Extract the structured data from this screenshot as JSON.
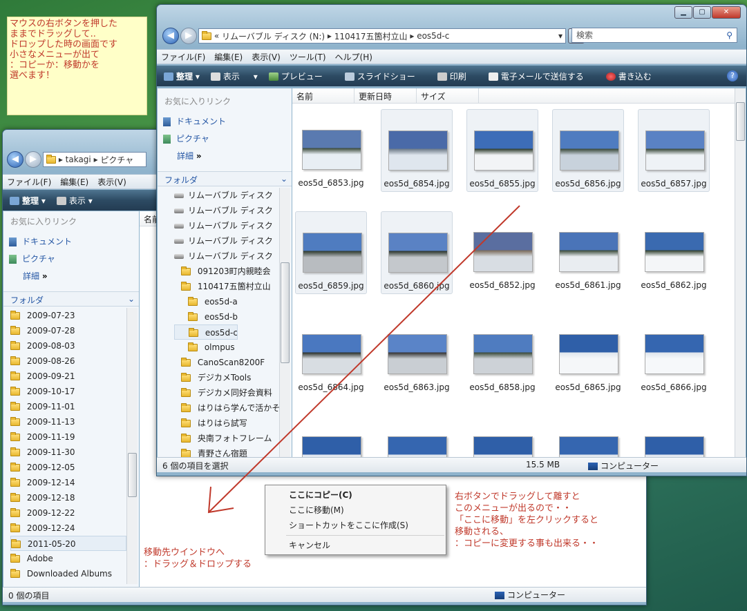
{
  "note": "マウスの右ボタンを押した\nままでドラッグして..\nドロップした時の画面です\n小さなメニューが出て\n：コピーか：移動かを\n選べます！",
  "back_window": {
    "breadcrumb": [
      "takagi",
      "ピクチャ"
    ],
    "menu": [
      "ファイル(F)",
      "編集(E)",
      "表示(V)"
    ],
    "toolbar": [
      "整理",
      "表示"
    ],
    "fav_header": "お気に入りリンク",
    "favs": [
      "ドキュメント",
      "ピクチャ"
    ],
    "more": "詳細",
    "folder_header": "フォルダ",
    "col": "名前",
    "folders": [
      "2009-07-23",
      "2009-07-28",
      "2009-08-03",
      "2009-08-26",
      "2009-09-21",
      "2009-10-17",
      "2009-11-01",
      "2009-11-13",
      "2009-11-19",
      "2009-11-30",
      "2009-12-05",
      "2009-12-14",
      "2009-12-18",
      "2009-12-22",
      "2009-12-24",
      "2011-05-20",
      "Adobe",
      "Downloaded Albums"
    ],
    "status": "0 個の項目",
    "computer": "コンピューター"
  },
  "front_window": {
    "breadcrumb": [
      "«",
      "リムーバブル ディスク (N:)",
      "110417五箇村立山",
      "eos5d-c"
    ],
    "search_placeholder": "検索",
    "menu": [
      "ファイル(F)",
      "編集(E)",
      "表示(V)",
      "ツール(T)",
      "ヘルプ(H)"
    ],
    "toolbar": [
      "整理",
      "表示",
      "プレビュー",
      "スライドショー",
      "印刷",
      "電子メールで送信する",
      "書き込む"
    ],
    "fav_header": "お気に入りリンク",
    "favs": [
      "ドキュメント",
      "ピクチャ"
    ],
    "more": "詳細",
    "folder_header": "フォルダ",
    "tree": [
      {
        "t": "drive",
        "label": "リムーバブル ディスク"
      },
      {
        "t": "drive",
        "label": "リムーバブル ディスク"
      },
      {
        "t": "drive",
        "label": "リムーバブル ディスク"
      },
      {
        "t": "drive",
        "label": "リムーバブル ディスク"
      },
      {
        "t": "drive",
        "label": "リムーバブル ディスク"
      },
      {
        "t": "f1",
        "label": "091203町内親睦会"
      },
      {
        "t": "f1",
        "label": "110417五箇村立山"
      },
      {
        "t": "f2",
        "label": "eos5d-a"
      },
      {
        "t": "f2",
        "label": "eos5d-b"
      },
      {
        "t": "f2",
        "label": "eos5d-c",
        "sel": true
      },
      {
        "t": "f2",
        "label": "olmpus"
      },
      {
        "t": "f1",
        "label": "CanoScan8200F"
      },
      {
        "t": "f1",
        "label": "デジカメTools"
      },
      {
        "t": "f1",
        "label": "デジカメ同好会資料"
      },
      {
        "t": "f1",
        "label": "はりはら学んで活かそ"
      },
      {
        "t": "f1",
        "label": "はりはら試写"
      },
      {
        "t": "f1",
        "label": "央南フォトフレーム"
      },
      {
        "t": "f1",
        "label": "青野さん宿題"
      }
    ],
    "columns": [
      "名前",
      "更新日時",
      "サイズ"
    ],
    "files": [
      {
        "name": "eos5d_6853.jpg",
        "sel": false
      },
      {
        "name": "eos5d_6854.jpg",
        "sel": true
      },
      {
        "name": "eos5d_6855.jpg",
        "sel": true
      },
      {
        "name": "eos5d_6856.jpg",
        "sel": true
      },
      {
        "name": "eos5d_6857.jpg",
        "sel": true
      },
      {
        "name": "eos5d_6859.jpg",
        "sel": true
      },
      {
        "name": "eos5d_6860.jpg",
        "sel": true
      },
      {
        "name": "eos5d_6852.jpg",
        "sel": false
      },
      {
        "name": "eos5d_6861.jpg",
        "sel": false
      },
      {
        "name": "eos5d_6862.jpg",
        "sel": false
      },
      {
        "name": "eos5d_6864.jpg",
        "sel": false
      },
      {
        "name": "eos5d_6863.jpg",
        "sel": false
      },
      {
        "name": "eos5d_6858.jpg",
        "sel": false
      },
      {
        "name": "eos5d_6865.jpg",
        "sel": false
      },
      {
        "name": "eos5d_6866.jpg",
        "sel": false
      },
      {
        "name": "",
        "sel": false
      },
      {
        "name": "",
        "sel": false
      },
      {
        "name": "",
        "sel": false
      },
      {
        "name": "",
        "sel": false
      },
      {
        "name": "",
        "sel": false
      }
    ],
    "status": "6 個の項目を選択",
    "size": "15.5 MB",
    "computer": "コンピューター"
  },
  "context_menu": [
    "ここにコピー(C)",
    "ここに移動(M)",
    "ショートカットをここに作成(S)",
    "キャンセル"
  ],
  "annot_right": "右ボタンでドラッグして離すと\nこのメニューが出るので・・\n「ここに移動」を左クリックすると\n移動される、\n：コピーに変更する事も出来る・・",
  "annot_left": "移動先ウインドウへ\n：ドラッグ＆ドロップする",
  "colors": {
    "annotation": "#c0392b",
    "note_bg": "#ffffc8"
  }
}
